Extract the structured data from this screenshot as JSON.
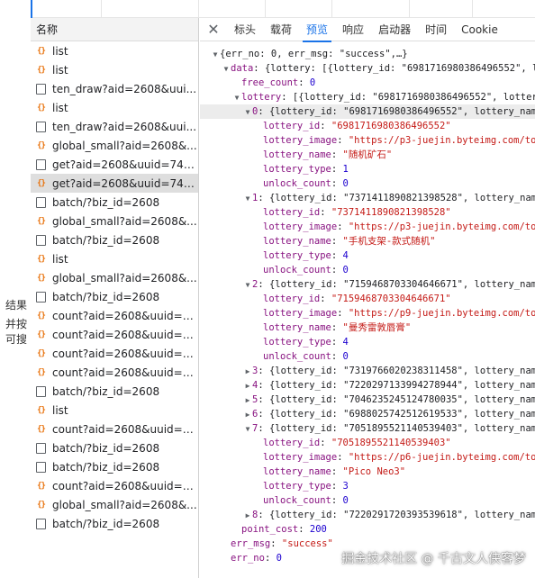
{
  "left_fragment": [
    "结果",
    "并按",
    "可搜"
  ],
  "name_panel": {
    "header": "名称",
    "requests": [
      {
        "icon": "script-icon",
        "label": "list"
      },
      {
        "icon": "script-icon",
        "label": "list"
      },
      {
        "icon": "document-icon",
        "label": "ten_draw?aid=2608&uui..."
      },
      {
        "icon": "script-icon",
        "label": "list"
      },
      {
        "icon": "document-icon",
        "label": "ten_draw?aid=2608&uui..."
      },
      {
        "icon": "script-icon",
        "label": "global_small?aid=2608&..."
      },
      {
        "icon": "document-icon",
        "label": "get?aid=2608&uuid=747..."
      },
      {
        "icon": "script-icon",
        "label": "get?aid=2608&uuid=747...",
        "selected": true
      },
      {
        "icon": "document-icon",
        "label": "batch/?biz_id=2608"
      },
      {
        "icon": "script-icon",
        "label": "global_small?aid=2608&..."
      },
      {
        "icon": "document-icon",
        "label": "batch/?biz_id=2608"
      },
      {
        "icon": "script-icon",
        "label": "list"
      },
      {
        "icon": "script-icon",
        "label": "global_small?aid=2608&..."
      },
      {
        "icon": "document-icon",
        "label": "batch/?biz_id=2608"
      },
      {
        "icon": "script-icon",
        "label": "count?aid=2608&uuid=7..."
      },
      {
        "icon": "script-icon",
        "label": "count?aid=2608&uuid=7..."
      },
      {
        "icon": "script-icon",
        "label": "count?aid=2608&uuid=7..."
      },
      {
        "icon": "script-icon",
        "label": "count?aid=2608&uuid=7..."
      },
      {
        "icon": "document-icon",
        "label": "batch/?biz_id=2608"
      },
      {
        "icon": "script-icon",
        "label": "list"
      },
      {
        "icon": "script-icon",
        "label": "count?aid=2608&uuid=7..."
      },
      {
        "icon": "document-icon",
        "label": "batch/?biz_id=2608"
      },
      {
        "icon": "document-icon",
        "label": "batch/?biz_id=2608"
      },
      {
        "icon": "script-icon",
        "label": "count?aid=2608&uuid=7..."
      },
      {
        "icon": "script-icon",
        "label": "global_small?aid=2608&..."
      },
      {
        "icon": "document-icon",
        "label": "batch/?biz_id=2608"
      }
    ]
  },
  "tabs": {
    "close": "✕",
    "items": [
      "标头",
      "载荷",
      "预览",
      "响应",
      "启动器",
      "时间",
      "Cookie"
    ],
    "active": "预览"
  },
  "preview_lines": [
    {
      "indent": 0,
      "tri": "down",
      "segs": [
        [
          "plain",
          "{err_no: 0, err_msg: \"success\",…}"
        ]
      ]
    },
    {
      "indent": 1,
      "tri": "down",
      "segs": [
        [
          "key",
          "data"
        ],
        [
          "plain",
          ": {lottery: [{lottery_id: \"6981716980386496552\", lot"
        ]
      ]
    },
    {
      "indent": 2,
      "tri": "none",
      "segs": [
        [
          "key",
          "free_count"
        ],
        [
          "plain",
          ": "
        ],
        [
          "num",
          "0"
        ]
      ]
    },
    {
      "indent": 2,
      "tri": "down",
      "segs": [
        [
          "key",
          "lottery"
        ],
        [
          "plain",
          ": [{lottery_id: \"6981716980386496552\", lottery_n"
        ]
      ]
    },
    {
      "indent": 3,
      "tri": "down",
      "hl": true,
      "segs": [
        [
          "key",
          "0"
        ],
        [
          "plain",
          ": {lottery_id: \"6981716980386496552\", lottery_name:"
        ]
      ]
    },
    {
      "indent": 4,
      "tri": "none",
      "segs": [
        [
          "key",
          "lottery_id"
        ],
        [
          "plain",
          ": "
        ],
        [
          "str",
          "\"6981716980386496552\""
        ]
      ]
    },
    {
      "indent": 4,
      "tri": "none",
      "segs": [
        [
          "key",
          "lottery_image"
        ],
        [
          "plain",
          ": "
        ],
        [
          "str",
          "\"https://p3-juejin.byteimg.com/tos-c"
        ]
      ]
    },
    {
      "indent": 4,
      "tri": "none",
      "segs": [
        [
          "key",
          "lottery_name"
        ],
        [
          "plain",
          ": "
        ],
        [
          "str",
          "\"随机矿石\""
        ]
      ]
    },
    {
      "indent": 4,
      "tri": "none",
      "segs": [
        [
          "key",
          "lottery_type"
        ],
        [
          "plain",
          ": "
        ],
        [
          "num",
          "1"
        ]
      ]
    },
    {
      "indent": 4,
      "tri": "none",
      "segs": [
        [
          "key",
          "unlock_count"
        ],
        [
          "plain",
          ": "
        ],
        [
          "num",
          "0"
        ]
      ]
    },
    {
      "indent": 3,
      "tri": "down",
      "segs": [
        [
          "key",
          "1"
        ],
        [
          "plain",
          ": {lottery_id: \"7371411890821398528\", lottery_name:"
        ]
      ]
    },
    {
      "indent": 4,
      "tri": "none",
      "segs": [
        [
          "key",
          "lottery_id"
        ],
        [
          "plain",
          ": "
        ],
        [
          "str",
          "\"7371411890821398528\""
        ]
      ]
    },
    {
      "indent": 4,
      "tri": "none",
      "segs": [
        [
          "key",
          "lottery_image"
        ],
        [
          "plain",
          ": "
        ],
        [
          "str",
          "\"https://p3-juejin.byteimg.com/tos-c"
        ]
      ]
    },
    {
      "indent": 4,
      "tri": "none",
      "segs": [
        [
          "key",
          "lottery_name"
        ],
        [
          "plain",
          ": "
        ],
        [
          "str",
          "\"手机支架-款式随机\""
        ]
      ]
    },
    {
      "indent": 4,
      "tri": "none",
      "segs": [
        [
          "key",
          "lottery_type"
        ],
        [
          "plain",
          ": "
        ],
        [
          "num",
          "4"
        ]
      ]
    },
    {
      "indent": 4,
      "tri": "none",
      "segs": [
        [
          "key",
          "unlock_count"
        ],
        [
          "plain",
          ": "
        ],
        [
          "num",
          "0"
        ]
      ]
    },
    {
      "indent": 3,
      "tri": "down",
      "segs": [
        [
          "key",
          "2"
        ],
        [
          "plain",
          ": {lottery_id: \"7159468703304646671\", lottery_name:"
        ]
      ]
    },
    {
      "indent": 4,
      "tri": "none",
      "segs": [
        [
          "key",
          "lottery_id"
        ],
        [
          "plain",
          ": "
        ],
        [
          "str",
          "\"7159468703304646671\""
        ]
      ]
    },
    {
      "indent": 4,
      "tri": "none",
      "segs": [
        [
          "key",
          "lottery_image"
        ],
        [
          "plain",
          ": "
        ],
        [
          "str",
          "\"https://p9-juejin.byteimg.com/tos-c"
        ]
      ]
    },
    {
      "indent": 4,
      "tri": "none",
      "segs": [
        [
          "key",
          "lottery_name"
        ],
        [
          "plain",
          ": "
        ],
        [
          "str",
          "\"曼秀雷敦唇膏\""
        ]
      ]
    },
    {
      "indent": 4,
      "tri": "none",
      "segs": [
        [
          "key",
          "lottery_type"
        ],
        [
          "plain",
          ": "
        ],
        [
          "num",
          "4"
        ]
      ]
    },
    {
      "indent": 4,
      "tri": "none",
      "segs": [
        [
          "key",
          "unlock_count"
        ],
        [
          "plain",
          ": "
        ],
        [
          "num",
          "0"
        ]
      ]
    },
    {
      "indent": 3,
      "tri": "right",
      "segs": [
        [
          "key",
          "3"
        ],
        [
          "plain",
          ": {lottery_id: \"7319766020238311458\", lottery_name:"
        ]
      ]
    },
    {
      "indent": 3,
      "tri": "right",
      "segs": [
        [
          "key",
          "4"
        ],
        [
          "plain",
          ": {lottery_id: \"7220297133994278944\", lottery_name:"
        ]
      ]
    },
    {
      "indent": 3,
      "tri": "right",
      "segs": [
        [
          "key",
          "5"
        ],
        [
          "plain",
          ": {lottery_id: \"7046235245124780035\", lottery_name:"
        ]
      ]
    },
    {
      "indent": 3,
      "tri": "right",
      "segs": [
        [
          "key",
          "6"
        ],
        [
          "plain",
          ": {lottery_id: \"6988025742512619533\", lottery_name:"
        ]
      ]
    },
    {
      "indent": 3,
      "tri": "down",
      "segs": [
        [
          "key",
          "7"
        ],
        [
          "plain",
          ": {lottery_id: \"7051895521140539403\", lottery_name:"
        ]
      ]
    },
    {
      "indent": 4,
      "tri": "none",
      "segs": [
        [
          "key",
          "lottery_id"
        ],
        [
          "plain",
          ": "
        ],
        [
          "str",
          "\"7051895521140539403\""
        ]
      ]
    },
    {
      "indent": 4,
      "tri": "none",
      "segs": [
        [
          "key",
          "lottery_image"
        ],
        [
          "plain",
          ": "
        ],
        [
          "str",
          "\"https://p6-juejin.byteimg.com/tos-c"
        ]
      ]
    },
    {
      "indent": 4,
      "tri": "none",
      "segs": [
        [
          "key",
          "lottery_name"
        ],
        [
          "plain",
          ": "
        ],
        [
          "str",
          "\"Pico Neo3\""
        ]
      ]
    },
    {
      "indent": 4,
      "tri": "none",
      "segs": [
        [
          "key",
          "lottery_type"
        ],
        [
          "plain",
          ": "
        ],
        [
          "num",
          "3"
        ]
      ]
    },
    {
      "indent": 4,
      "tri": "none",
      "segs": [
        [
          "key",
          "unlock_count"
        ],
        [
          "plain",
          ": "
        ],
        [
          "num",
          "0"
        ]
      ]
    },
    {
      "indent": 3,
      "tri": "right",
      "segs": [
        [
          "key",
          "8"
        ],
        [
          "plain",
          ": {lottery_id: \"7220291720393539618\", lottery_name:"
        ]
      ]
    },
    {
      "indent": 2,
      "tri": "none",
      "segs": [
        [
          "key",
          "point_cost"
        ],
        [
          "plain",
          ": "
        ],
        [
          "num",
          "200"
        ]
      ]
    },
    {
      "indent": 1,
      "tri": "none",
      "segs": [
        [
          "key",
          "err_msg"
        ],
        [
          "plain",
          ": "
        ],
        [
          "str",
          "\"success\""
        ]
      ]
    },
    {
      "indent": 1,
      "tri": "none",
      "segs": [
        [
          "key",
          "err_no"
        ],
        [
          "plain",
          ": "
        ],
        [
          "num",
          "0"
        ]
      ]
    }
  ],
  "watermark": "掘金技术社区 @ 千古文人侠客梦",
  "colors": {
    "accent": "#1a73e8",
    "key": "#881280",
    "number": "#1c00cf",
    "string": "#c41a16",
    "script_icon": "#e8710a"
  }
}
